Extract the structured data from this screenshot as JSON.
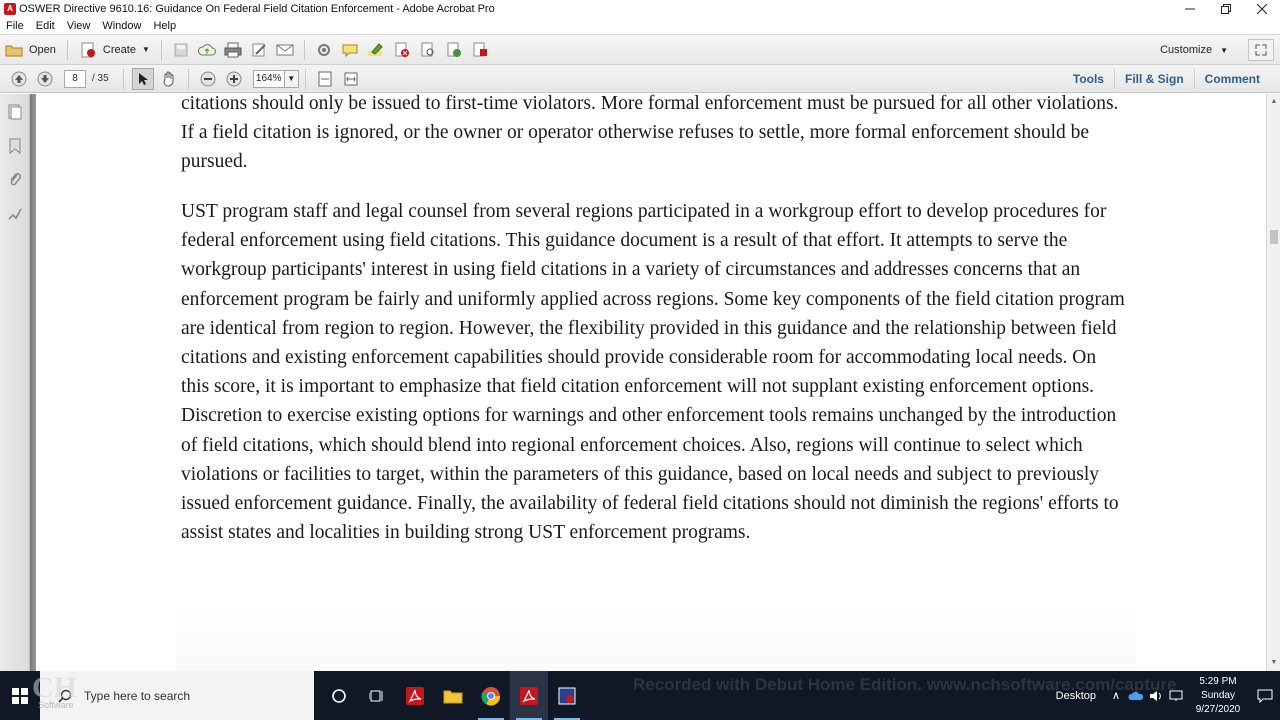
{
  "window": {
    "title": "OSWER Directive 9610.16: Guidance On Federal Field Citation Enforcement - Adobe Acrobat Pro"
  },
  "menubar": {
    "items": [
      "File",
      "Edit",
      "View",
      "Window",
      "Help"
    ]
  },
  "toolbar": {
    "open_label": "Open",
    "create_label": "Create",
    "customize_label": "Customize"
  },
  "navbar": {
    "current_page": "8",
    "total_pages": "/ 35",
    "zoom": "164%",
    "links": [
      "Tools",
      "Fill & Sign",
      "Comment"
    ]
  },
  "document": {
    "paragraph1": "citations should only be issued to first-time violators. More formal enforcement must be pursued for all other violations. If a field citation is ignored, or the owner or operator otherwise refuses to settle, more formal enforcement should be pursued.",
    "paragraph2": "UST program staff and legal counsel from several regions participated in a workgroup effort to develop procedures for federal enforcement using field citations. This guidance document is a result of that effort. It attempts to serve the workgroup participants' interest in using field citations in a variety of circumstances and addresses concerns that an enforcement program be fairly and uniformly applied across regions. Some key components of the field citation program are identical from region to region. However, the flexibility provided in this guidance and the relationship between field citations and existing enforcement capabilities should provide considerable room for accommodating local needs. On this score, it is important to emphasize that field citation enforcement will not supplant existing enforcement options. Discretion to exercise existing options for warnings and other enforcement tools remains unchanged by the introduction of field citations, which should blend into regional enforcement choices. Also, regions will continue to select which violations or facilities to target, within the parameters of this guidance, based on local needs and subject to previously issued enforcement guidance. Finally, the availability of federal field citations should not diminish the regions' efforts to assist states and localities in building strong UST enforcement programs."
  },
  "taskbar": {
    "search_placeholder": "Type here to search",
    "watermark": "Recorded with Debut Home Edition. www.nchsoftware.com/capture",
    "desktop_label": "Desktop",
    "time": "5:29 PM",
    "day": "Sunday",
    "date": "9/27/2020",
    "logo_text": "Software"
  },
  "colors": {
    "link_blue": "#2f5f8f",
    "taskbar_bg": "#101826",
    "acrobat_red": "#c8161d"
  }
}
